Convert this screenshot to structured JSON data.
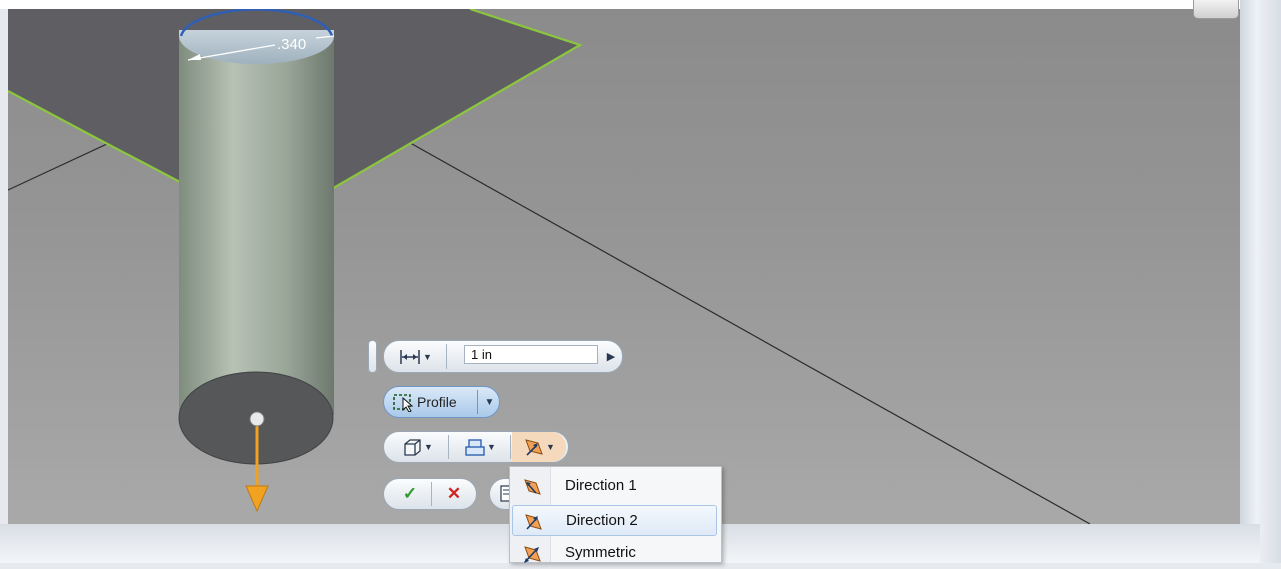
{
  "viewport": {
    "dimension_label": ".340"
  },
  "minitoolbar": {
    "distance_value": "1 in",
    "profile_label": "Profile"
  },
  "direction_menu": {
    "items": [
      {
        "label": "Direction 1",
        "icon": "direction-1-icon"
      },
      {
        "label": "Direction 2",
        "icon": "direction-2-icon",
        "highlighted": true
      },
      {
        "label": "Symmetric",
        "icon": "symmetric-icon"
      }
    ]
  },
  "colors": {
    "sketch_plane_outline": "#8cc63f",
    "sketch_plane_fill": "#5f5f63",
    "cylinder_body": "#9aa79a",
    "arrow": "#f0a220",
    "ok_green": "#2f9a2f",
    "cancel_red": "#d02424",
    "menu_highlight": "#dfeaf7"
  }
}
